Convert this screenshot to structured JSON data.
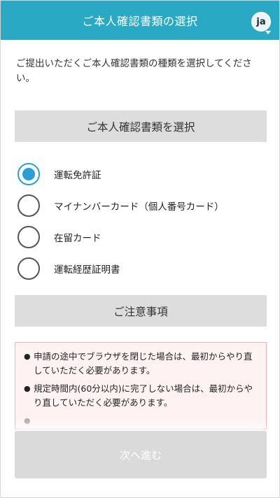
{
  "header": {
    "title": "ご本人確認書類の選択",
    "lang_label": "ja"
  },
  "intro_text": "ご提出いただくご本人確認書類の種類を選択してください。",
  "select_section": {
    "label": "ご本人確認書類を選択"
  },
  "options": [
    {
      "label": "運転免許証",
      "selected": true
    },
    {
      "label": "マイナンバーカード（個人番号カード）",
      "selected": false
    },
    {
      "label": "在留カード",
      "selected": false
    },
    {
      "label": "運転経歴証明書",
      "selected": false
    }
  ],
  "notes_section": {
    "label": "ご注意事項",
    "items": [
      "申請の途中でブラウザを閉じた場合は、最初からやり直していただく必要があります。",
      "規定時間内(60分以内)に完了しない場合は、最初からやり直していただく必要があります。"
    ]
  },
  "next_button": {
    "label": "次へ進む"
  },
  "colors": {
    "header_bg": "#2aa9c4",
    "radio_selected": "#2a9fd6",
    "notes_bg": "#fff2f2",
    "notes_border": "#f3b4b4",
    "button_disabled": "#dadada"
  }
}
